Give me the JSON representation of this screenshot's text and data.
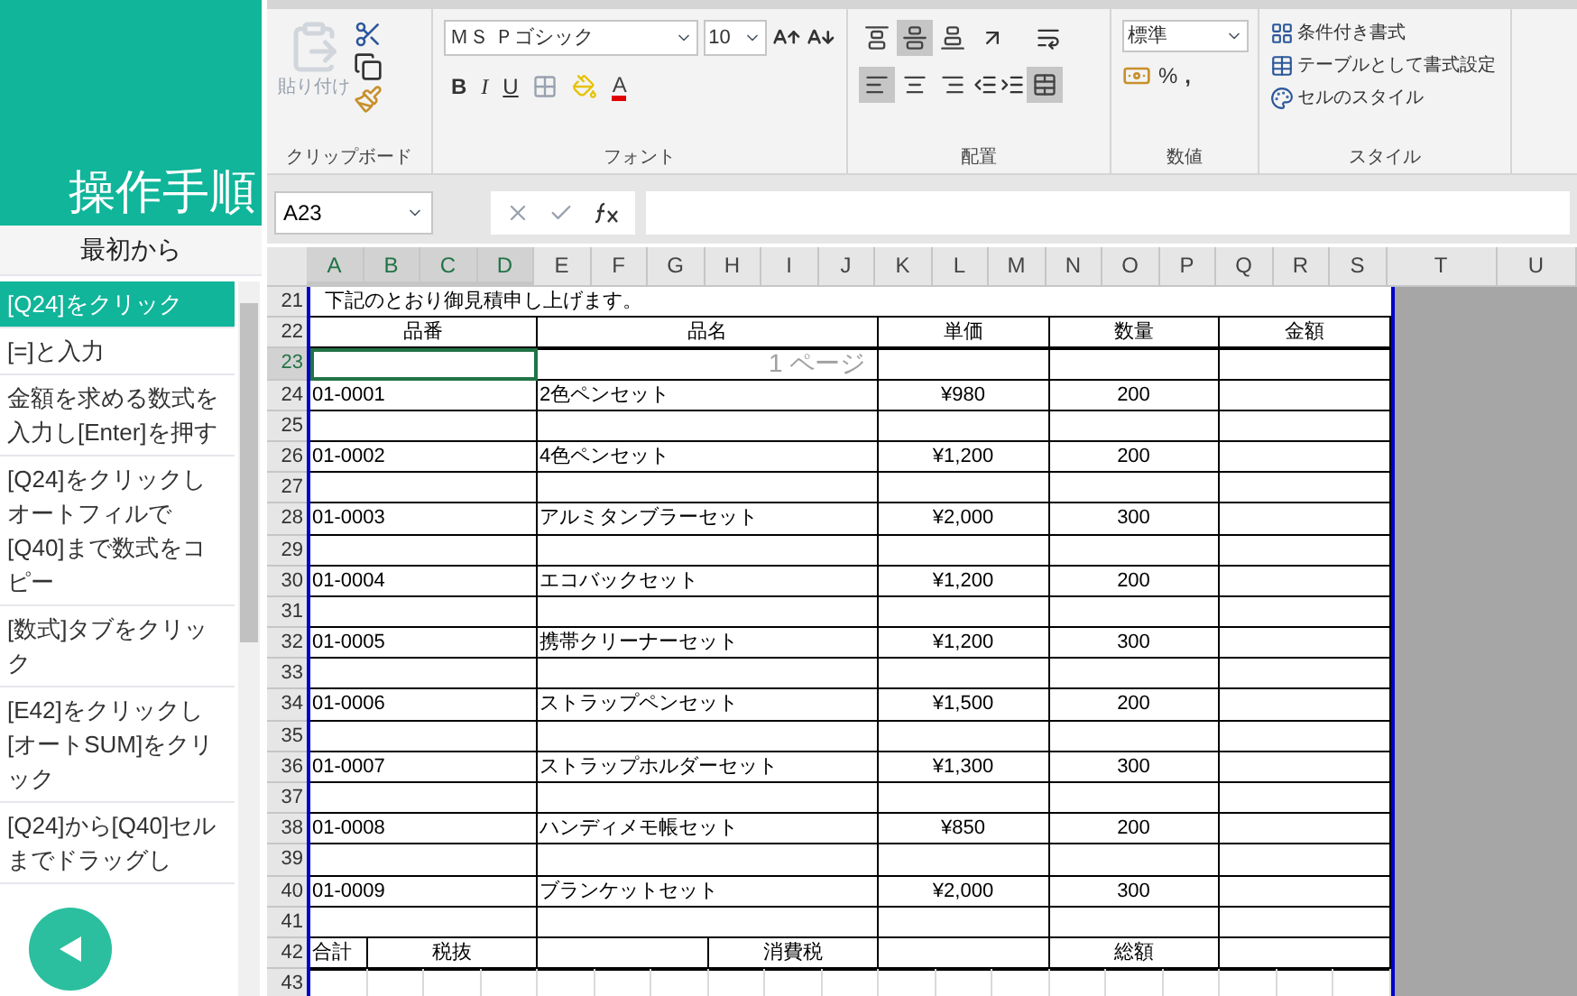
{
  "sidebar": {
    "title": "操作手順",
    "restart": "最初から",
    "steps": [
      {
        "text": "[Q24]をクリック",
        "selected": true
      },
      {
        "text": "[=]と入力",
        "selected": false
      },
      {
        "text": "金額を求める数式を入力し[Enter]を押す",
        "selected": false
      },
      {
        "text": "[Q24]をクリックしオートフィルで[Q40]まで数式をコピー",
        "selected": false
      },
      {
        "text": "[数式]タブをクリック",
        "selected": false
      },
      {
        "text": "[E42]をクリックし[オートSUM]をクリック",
        "selected": false
      },
      {
        "text": "[Q24]から[Q40]セルまでドラッグし",
        "selected": false
      }
    ]
  },
  "ribbon": {
    "clipboard": {
      "paste": "貼り付け",
      "label": "クリップボード"
    },
    "font": {
      "name": "ＭＳ Ｐゴシック",
      "size": "10",
      "bold": "B",
      "italic": "I",
      "underline": "U",
      "font_color": "A",
      "label": "フォント"
    },
    "alignment": {
      "label": "配置",
      "vertical": [
        {
          "kind": "top",
          "selected": false
        },
        {
          "kind": "middle",
          "selected": true
        },
        {
          "kind": "bottom",
          "selected": false
        }
      ],
      "horizontal": [
        {
          "kind": "left",
          "selected": true
        },
        {
          "kind": "center",
          "selected": false
        },
        {
          "kind": "right",
          "selected": false
        }
      ],
      "merge": {
        "selected": true
      }
    },
    "number": {
      "format": "標準",
      "percent": "%",
      "comma": ",",
      "label": "数値"
    },
    "styles": {
      "items": [
        "条件付き書式",
        "テーブルとして書式設定",
        "セルのスタイル"
      ],
      "label": "スタイル"
    }
  },
  "formula_bar": {
    "name_box": "A23"
  },
  "sheet": {
    "page_label": "1 ページ",
    "columns": [
      {
        "label": "A",
        "selected": true
      },
      {
        "label": "B",
        "selected": true
      },
      {
        "label": "C",
        "selected": true
      },
      {
        "label": "D",
        "selected": true
      },
      {
        "label": "E",
        "selected": false
      },
      {
        "label": "F",
        "selected": false
      },
      {
        "label": "G",
        "selected": false
      },
      {
        "label": "H",
        "selected": false
      },
      {
        "label": "I",
        "selected": false
      },
      {
        "label": "J",
        "selected": false
      },
      {
        "label": "K",
        "selected": false
      },
      {
        "label": "L",
        "selected": false
      },
      {
        "label": "M",
        "selected": false
      },
      {
        "label": "N",
        "selected": false
      },
      {
        "label": "O",
        "selected": false
      },
      {
        "label": "P",
        "selected": false
      },
      {
        "label": "Q",
        "selected": false
      },
      {
        "label": "R",
        "selected": false
      },
      {
        "label": "S",
        "selected": false
      },
      {
        "label": "T",
        "selected": false
      },
      {
        "label": "U",
        "selected": false
      }
    ],
    "rows": [
      {
        "num": "21",
        "kind": "note",
        "selected": false,
        "text": "下記のとおり御見積申し上げます。"
      },
      {
        "num": "22",
        "kind": "header",
        "selected": false,
        "cells": [
          "品番",
          "品名",
          "単価",
          "数量",
          "金額"
        ]
      },
      {
        "num": "23",
        "kind": "blank",
        "selected": true
      },
      {
        "num": "24",
        "kind": "item",
        "selected": false,
        "cells": [
          "01-0001",
          "2色ペンセット",
          "¥980",
          "200"
        ]
      },
      {
        "num": "25",
        "kind": "blank",
        "selected": false
      },
      {
        "num": "26",
        "kind": "item",
        "selected": false,
        "cells": [
          "01-0002",
          "4色ペンセット",
          "¥1,200",
          "200"
        ]
      },
      {
        "num": "27",
        "kind": "blank",
        "selected": false
      },
      {
        "num": "28",
        "kind": "item",
        "selected": false,
        "cells": [
          "01-0003",
          "アルミタンブラーセット",
          "¥2,000",
          "300"
        ]
      },
      {
        "num": "29",
        "kind": "blank",
        "selected": false
      },
      {
        "num": "30",
        "kind": "item",
        "selected": false,
        "cells": [
          "01-0004",
          "エコバックセット",
          "¥1,200",
          "200"
        ]
      },
      {
        "num": "31",
        "kind": "blank",
        "selected": false
      },
      {
        "num": "32",
        "kind": "item",
        "selected": false,
        "cells": [
          "01-0005",
          "携帯クリーナーセット",
          "¥1,200",
          "300"
        ]
      },
      {
        "num": "33",
        "kind": "blank",
        "selected": false
      },
      {
        "num": "34",
        "kind": "item",
        "selected": false,
        "cells": [
          "01-0006",
          "ストラップペンセット",
          "¥1,500",
          "200"
        ]
      },
      {
        "num": "35",
        "kind": "blank",
        "selected": false
      },
      {
        "num": "36",
        "kind": "item",
        "selected": false,
        "cells": [
          "01-0007",
          "ストラップホルダーセット",
          "¥1,300",
          "300"
        ]
      },
      {
        "num": "37",
        "kind": "blank",
        "selected": false
      },
      {
        "num": "38",
        "kind": "item",
        "selected": false,
        "cells": [
          "01-0008",
          "ハンディメモ帳セット",
          "¥850",
          "200"
        ]
      },
      {
        "num": "39",
        "kind": "blank",
        "selected": false
      },
      {
        "num": "40",
        "kind": "item",
        "selected": false,
        "cells": [
          "01-0009",
          "ブランケットセット",
          "¥2,000",
          "300"
        ]
      },
      {
        "num": "41",
        "kind": "blank",
        "selected": false
      },
      {
        "num": "42",
        "kind": "total",
        "selected": false,
        "cells": [
          "合計",
          "税抜",
          "消費税",
          "総額"
        ]
      },
      {
        "num": "43",
        "kind": "empty",
        "selected": false
      }
    ]
  }
}
